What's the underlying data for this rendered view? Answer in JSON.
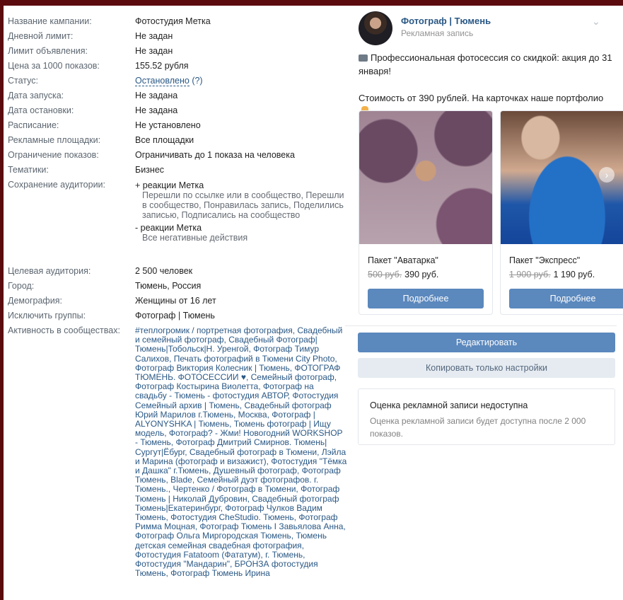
{
  "settings": [
    {
      "label": "Название кампании:",
      "value": "Фотостудия Метка",
      "link": false
    },
    {
      "label": "Дневной лимит:",
      "value": "Не задан",
      "link": true
    },
    {
      "label": "Лимит объявления:",
      "value": "Не задан",
      "link": true
    },
    {
      "label": "Цена за 1000 показов:",
      "value": "155.52 рубля",
      "link": true
    },
    {
      "label": "Статус:",
      "value": "Остановлено",
      "extra": "(?)",
      "link": true
    },
    {
      "label": "Дата запуска:",
      "value": "Не задана",
      "link": true
    },
    {
      "label": "Дата остановки:",
      "value": "Не задана",
      "link": true
    },
    {
      "label": "Расписание:",
      "value": "Не установлено",
      "link": true
    },
    {
      "label": "Рекламные площадки:",
      "value": "Все площадки",
      "link": false
    },
    {
      "label": "Ограничение показов:",
      "value": "Ограничивать до 1 показа на человека",
      "link": false
    },
    {
      "label": "Тематики:",
      "value": "Бизнес",
      "link": false
    }
  ],
  "audience_save": {
    "label": "Сохранение аудитории:",
    "plus_title": "+ реакции Метка",
    "plus_text": "Перешли по ссылке или в сообщество, Перешли в сообщество, Понравилась запись, Поделились записью, Подписались на сообщество",
    "minus_title": "- реакции Метка",
    "minus_text": "Все негативные действия"
  },
  "settings2": [
    {
      "label": "Целевая аудитория:",
      "value": "2 500 человек",
      "link": false
    },
    {
      "label": "Город:",
      "value": "Тюмень, Россия",
      "link": false
    },
    {
      "label": "Демография:",
      "value": "Женщины от 16 лет",
      "link": false
    },
    {
      "label": "Исключить группы:",
      "value": "Фотограф | Тюмень",
      "link": true
    }
  ],
  "activity": {
    "label": "Активность в сообществах:",
    "text": "#теплогромик / портретная фотография, Свадебный и семейный фотограф, Свадебный Фотограф|Тюмень|Тобольск|Н. Уренгой, Фотограф Тимур Салихов, Печать фотографий в Тюмени City Photo, Фотограф Виктория Колесник | Тюмень, ФОТОГРАФ ТЮМЕНЬ. ФОТОСЕССИИ ♥, Семейный фотограф, Фотограф Костырина Виолетта, Фотограф на свадьбу - Тюмень - фотостудия АВТОР, Фотостудия Семейный архив | Тюмень, Свадебный фотограф Юрий Марилов г.Тюмень, Москва, Фотограф | ALYONYSHKA | Тюмень, Тюмень фотограф | Ищу модель, Фотограф? - Жми! Новогодний WORKSHOP - Тюмень, Фотограф Дмитрий Смирнов. Тюмень|Сургут|Ёбург, Свадебный фотограф в Тюмени, Лэйла и Марина (фотограф и визажист), Фотостудия \"Тёмка и Дашка\" г.Тюмень, Душевный фотограф, Фотограф Тюмень, Blade, Семейный дуэт фотографов. г. Тюмень., Чертенко / Фотограф в Тюмени, Фотограф Тюмень | Николай Дубровин, Свадебный фотограф Тюмень|Екатеринбург, Фотограф Чулков Вадим Тюмень, Фотостудия CheStudio. Тюмень, Фотограф Римма Моцная, Фотограф Тюмень I Завьялова Анна, Фотограф Ольга Миргородская Тюмень, Тюмень детская семейная свадебная фотография, Фотостудия Fatatoom (Фататум), г. Тюмень, Фотостудия \"Мандарин\", БРОНЗА фотостудия Тюмень, Фотограф Тюмень Ирина"
  },
  "post": {
    "author": "Фотограф | Тюмень",
    "sponsored": "Рекламная запись",
    "line1": "Профессиональная фотосессия со скидкой: акция до 31 января!",
    "line2": "Стоимость от 390 рублей. На карточках наше портфолио"
  },
  "cards": [
    {
      "title": "Пакет \"Аватарка\"",
      "old_price": "500 руб.",
      "price": "390 руб.",
      "button": "Подробнее"
    },
    {
      "title": "Пакет \"Экспресс\"",
      "old_price": "1 900 руб.",
      "price": "1 190 руб.",
      "button": "Подробнее"
    }
  ],
  "actions": {
    "edit": "Редактировать",
    "copy": "Копировать только настройки"
  },
  "estimate": {
    "title": "Оценка рекламной записи недоступна",
    "text": "Оценка рекламной записи будет доступна после 2 000 показов."
  },
  "colors": {
    "accent": "#5b88bd",
    "link": "#2a5885",
    "border_bg": "#5b0a0e"
  }
}
